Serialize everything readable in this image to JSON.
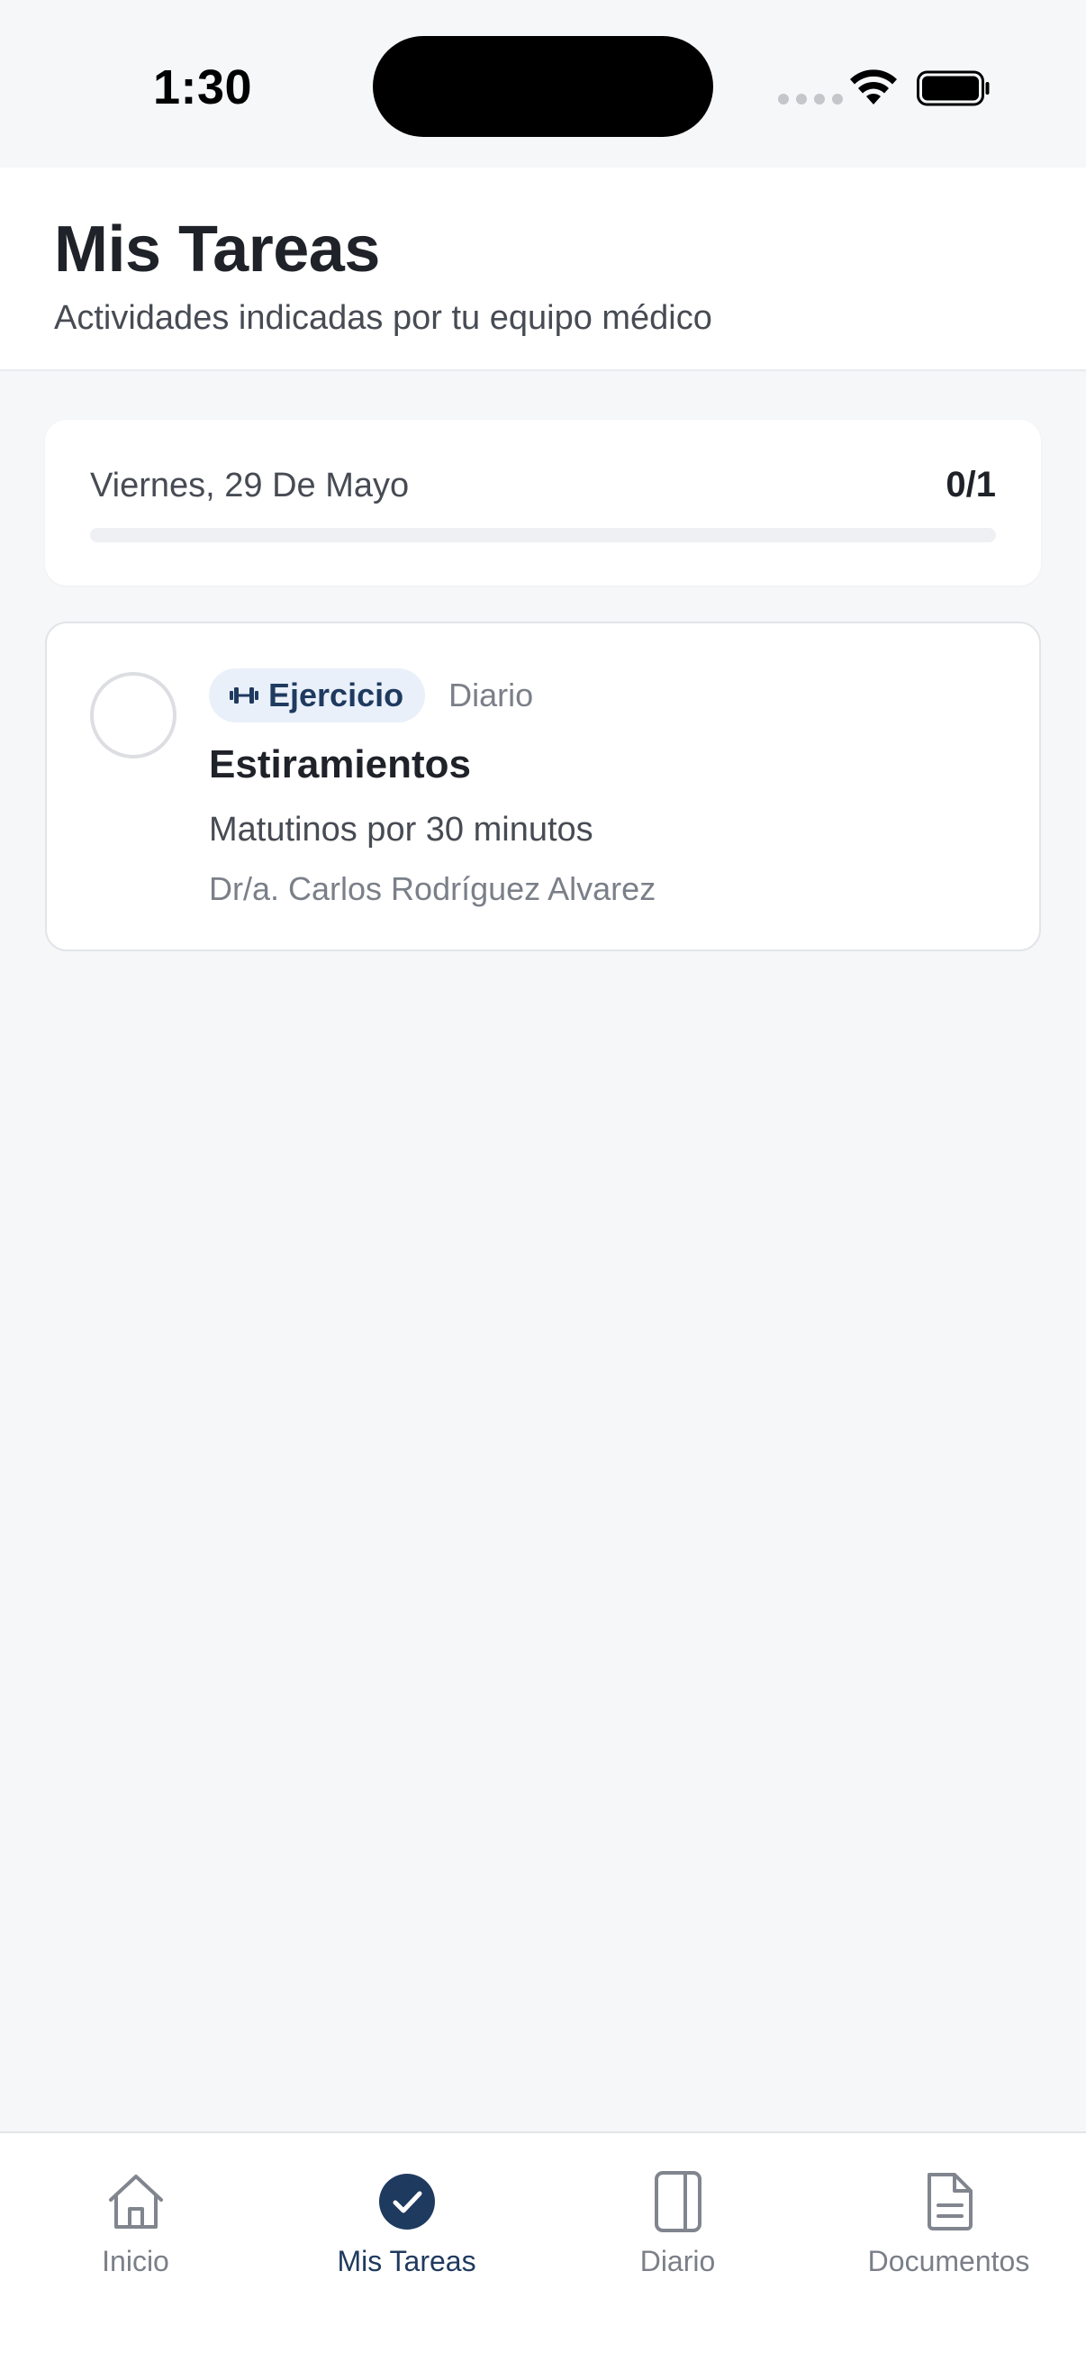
{
  "status_bar": {
    "time": "1:30",
    "icons": [
      "signal-icon",
      "wifi-icon",
      "battery-icon"
    ]
  },
  "header": {
    "title": "Mis Tareas",
    "subtitle": "Actividades indicadas por tu equipo médico"
  },
  "progress": {
    "date_label": "Viernes, 29 De Mayo",
    "count_label": "0/1",
    "completed": 0,
    "total": 1
  },
  "tasks": [
    {
      "category_icon": "dumbbell-icon",
      "category": "Ejercicio",
      "frequency": "Diario",
      "title": "Estiramientos",
      "description": "Matutinos por 30 minutos",
      "doctor": "Dr/a. Carlos Rodríguez Alvarez",
      "completed": false
    }
  ],
  "tab_bar": {
    "items": [
      {
        "label": "Inicio",
        "icon": "home-icon",
        "active": false
      },
      {
        "label": "Mis Tareas",
        "icon": "check-circle-icon",
        "active": true
      },
      {
        "label": "Diario",
        "icon": "journal-icon",
        "active": false
      },
      {
        "label": "Documentos",
        "icon": "document-icon",
        "active": false
      }
    ]
  },
  "colors": {
    "accent": "#1f3a5f",
    "background": "#f6f7f9",
    "badge_bg": "#e9f0fa",
    "muted_text": "#7a7f88"
  }
}
